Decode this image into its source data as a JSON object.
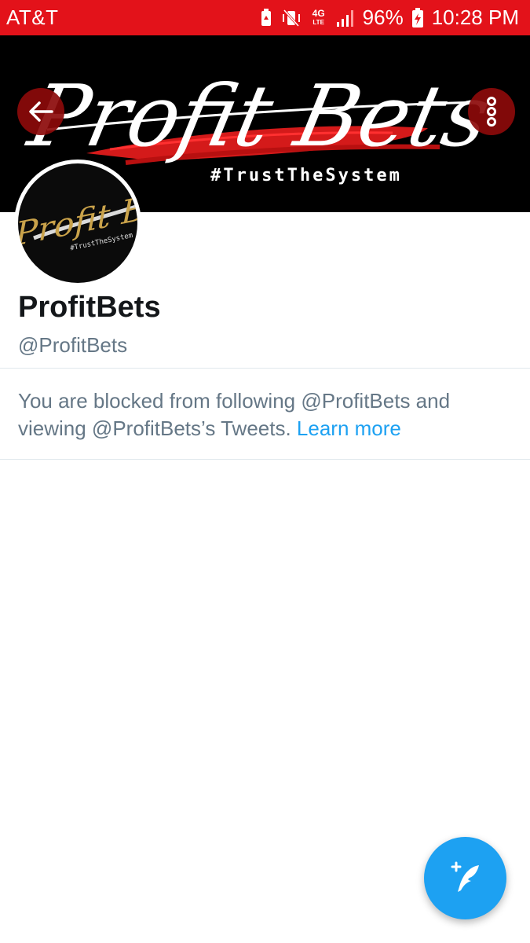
{
  "status_bar": {
    "carrier": "AT&T",
    "network": "4G",
    "network_sub": "LTE",
    "battery": "96%",
    "time": "10:28 PM",
    "icons": [
      "battery-saver-icon",
      "vibrate-icon",
      "network-4g-lte-icon",
      "signal-icon",
      "battery-charging-icon"
    ]
  },
  "banner": {
    "logo_text": "Profit Bets",
    "hashtag": "#TrustTheSystem"
  },
  "avatar": {
    "logo_text": "Profit Bets",
    "hashtag": "#TrustTheSystem"
  },
  "profile": {
    "display_name": "ProfitBets",
    "handle": "@ProfitBets"
  },
  "blocked": {
    "message": "You are blocked from following @ProfitBets and viewing @ProfitBets’s Tweets. ",
    "link": "Learn more"
  },
  "colors": {
    "status_bar": "#e3121a",
    "accent": "#1da1f2",
    "text_primary": "#14171a",
    "text_secondary": "#657786"
  }
}
